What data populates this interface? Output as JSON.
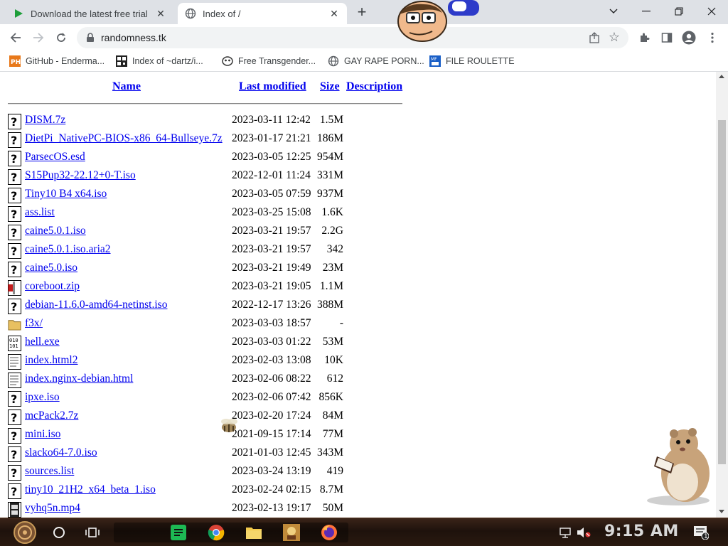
{
  "browser": {
    "tabs": [
      {
        "title": "Download the latest free trial",
        "active": false,
        "favicon": "green-play-icon"
      },
      {
        "title": "Index of /",
        "active": true,
        "favicon": "globe-icon"
      }
    ],
    "url": "randomness.tk"
  },
  "bookmarks": [
    {
      "label": "GitHub - Enderma...",
      "icon": "ph-icon"
    },
    {
      "label": "Index of ~dartz/i...",
      "icon": "qr-icon"
    },
    {
      "label": "Free Transgender...",
      "icon": "mask-icon"
    },
    {
      "label": "GAY RAPE PORN...",
      "icon": "globe-icon"
    },
    {
      "label": "FILE ROULETTE",
      "icon": "mf-icon"
    }
  ],
  "listing": {
    "columns": {
      "name": "Name",
      "modified": "Last modified",
      "size": "Size",
      "description": "Description"
    },
    "rows": [
      {
        "name": "DISM.7z",
        "date": "2023-03-11 12:42",
        "size": "1.5M",
        "type": "unknown"
      },
      {
        "name": "DietPi_NativePC-BIOS-x86_64-Bullseye.7z",
        "date": "2023-01-17 21:21",
        "size": "186M",
        "type": "unknown"
      },
      {
        "name": "ParsecOS.esd",
        "date": "2023-03-05 12:25",
        "size": "954M",
        "type": "unknown"
      },
      {
        "name": "S15Pup32-22.12+0-T.iso",
        "date": "2022-12-01 11:24",
        "size": "331M",
        "type": "unknown"
      },
      {
        "name": "Tiny10 B4 x64.iso",
        "date": "2023-03-05 07:59",
        "size": "937M",
        "type": "unknown"
      },
      {
        "name": "ass.list",
        "date": "2023-03-25 15:08",
        "size": "1.6K",
        "type": "unknown"
      },
      {
        "name": "caine5.0.1.iso",
        "date": "2023-03-21 19:57",
        "size": "2.2G",
        "type": "unknown"
      },
      {
        "name": "caine5.0.1.iso.aria2",
        "date": "2023-03-21 19:57",
        "size": "342",
        "type": "unknown"
      },
      {
        "name": "caine5.0.iso",
        "date": "2023-03-21 19:49",
        "size": "23M",
        "type": "unknown"
      },
      {
        "name": "coreboot.zip",
        "date": "2023-03-21 19:05",
        "size": "1.1M",
        "type": "compressed"
      },
      {
        "name": "debian-11.6.0-amd64-netinst.iso",
        "date": "2022-12-17 13:26",
        "size": "388M",
        "type": "unknown"
      },
      {
        "name": "f3x/",
        "date": "2023-03-03 18:57",
        "size": "-",
        "type": "folder"
      },
      {
        "name": "hell.exe",
        "date": "2023-03-03 01:22",
        "size": "53M",
        "type": "binary"
      },
      {
        "name": "index.html2",
        "date": "2023-02-03 13:08",
        "size": "10K",
        "type": "text"
      },
      {
        "name": "index.nginx-debian.html",
        "date": "2023-02-06 08:22",
        "size": "612",
        "type": "text"
      },
      {
        "name": "ipxe.iso",
        "date": "2023-02-06 07:42",
        "size": "856K",
        "type": "unknown"
      },
      {
        "name": "mcPack2.7z",
        "date": "2023-02-20 17:24",
        "size": "84M",
        "type": "unknown"
      },
      {
        "name": "mini.iso",
        "date": "2021-09-15 17:14",
        "size": "77M",
        "type": "unknown"
      },
      {
        "name": "slacko64-7.0.iso",
        "date": "2021-01-03 12:45",
        "size": "343M",
        "type": "unknown"
      },
      {
        "name": "sources.list",
        "date": "2023-03-24 13:19",
        "size": "419",
        "type": "unknown"
      },
      {
        "name": "tiny10_21H2_x64_beta_1.iso",
        "date": "2023-02-24 02:15",
        "size": "8.7M",
        "type": "unknown"
      },
      {
        "name": "vyhq5n.mp4",
        "date": "2023-02-13 19:17",
        "size": "50M",
        "type": "movie"
      }
    ]
  },
  "taskbar": {
    "clock": "9:15 AM",
    "apps": [
      "start-icon",
      "search-circle-icon",
      "task-view-icon",
      "notes-icon",
      "chrome-icon",
      "file-explorer-icon",
      "game-icon",
      "firefox-icon"
    ],
    "notification_count": "1"
  },
  "colors": {
    "link": "#0000ee",
    "tabstrip": "#dee1e6",
    "omnibox": "#f1f3f4"
  }
}
